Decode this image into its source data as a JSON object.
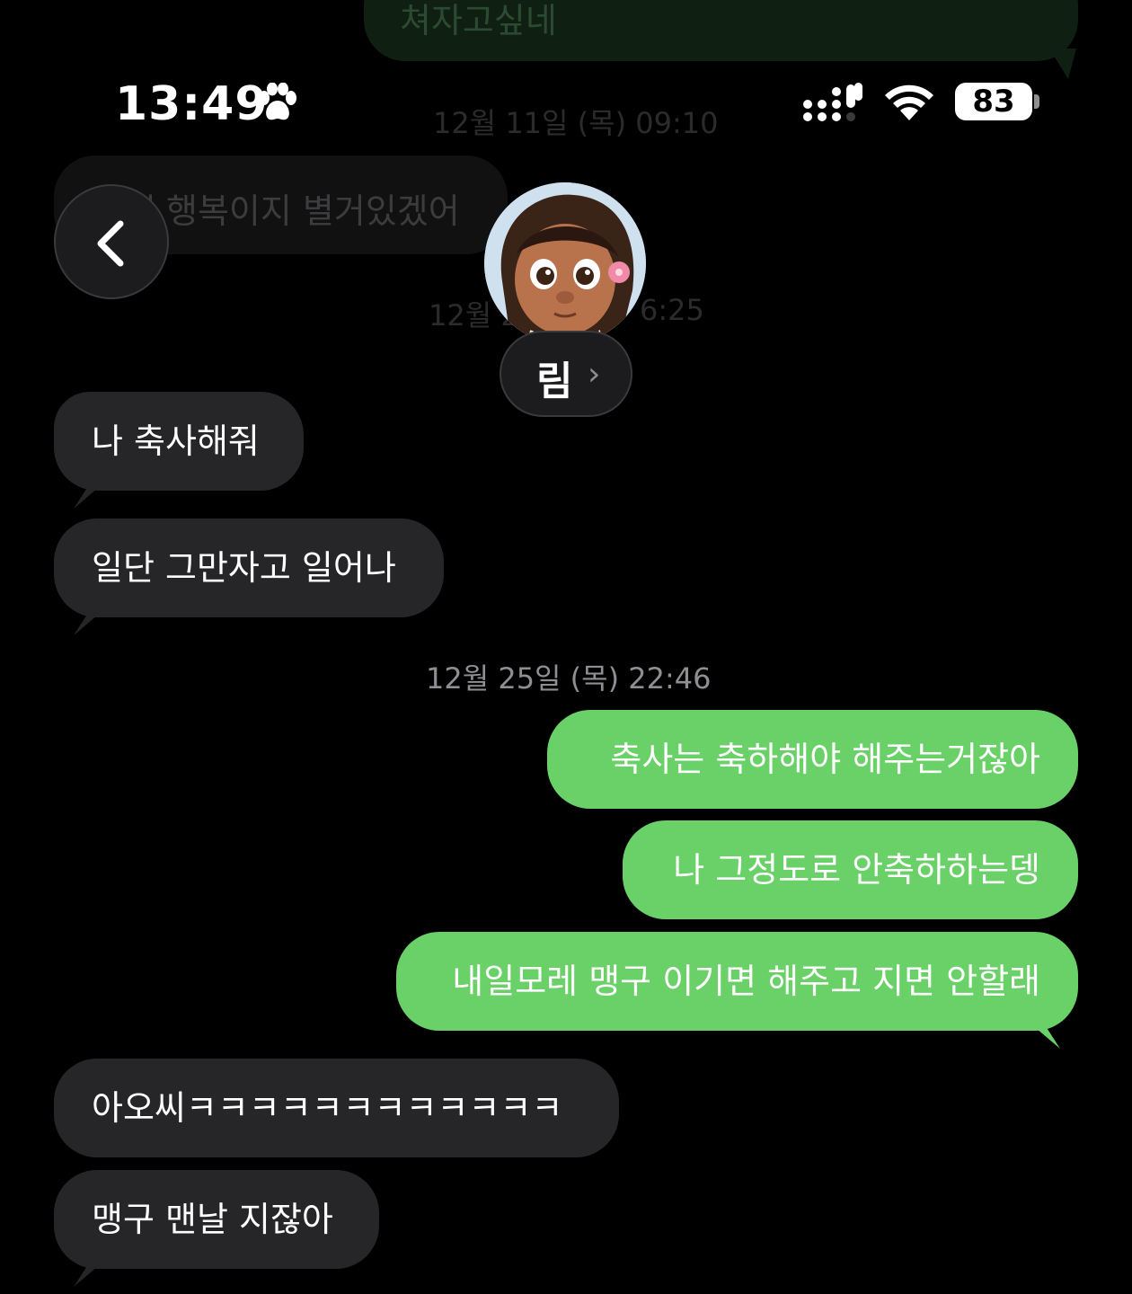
{
  "status_bar": {
    "time": "13:49",
    "battery": "83"
  },
  "contact": {
    "name": "림"
  },
  "icons": {
    "back": "chevron-left-icon",
    "paw": "paw-icon",
    "signal": "signal-icon",
    "wifi": "wifi-icon",
    "battery": "battery-icon",
    "name_chevron": "chevron-right-icon"
  },
  "colors": {
    "outgoing": "#6ad068",
    "incoming": "#262628",
    "background": "#000000"
  },
  "faded": {
    "top_message": "쳐자고싶네",
    "timestamp_1": "12월 11일 (목) 09:10",
    "message_2": "그게 행복이지 별거있겠어",
    "timestamp_2_left": "12월 2",
    "timestamp_2_right": "6:25"
  },
  "messages": [
    {
      "side": "in",
      "text": "나 축사해줘"
    },
    {
      "side": "in",
      "text": "일단 그만자고 일어나"
    },
    {
      "side": "timestamp",
      "text": "12월 25일 (목) 22:46"
    },
    {
      "side": "out",
      "text": "축사는 축하해야 해주는거잖아"
    },
    {
      "side": "out",
      "text": "나 그정도로 안축하하는뎅"
    },
    {
      "side": "out",
      "text": "내일모레 맹구 이기면 해주고 지면 안할래"
    },
    {
      "side": "in",
      "text": "아오씨ㅋㅋㅋㅋㅋㅋㅋㅋㅋㅋㅋㅋ"
    },
    {
      "side": "in",
      "text": "맹구 맨날 지잖아"
    }
  ]
}
